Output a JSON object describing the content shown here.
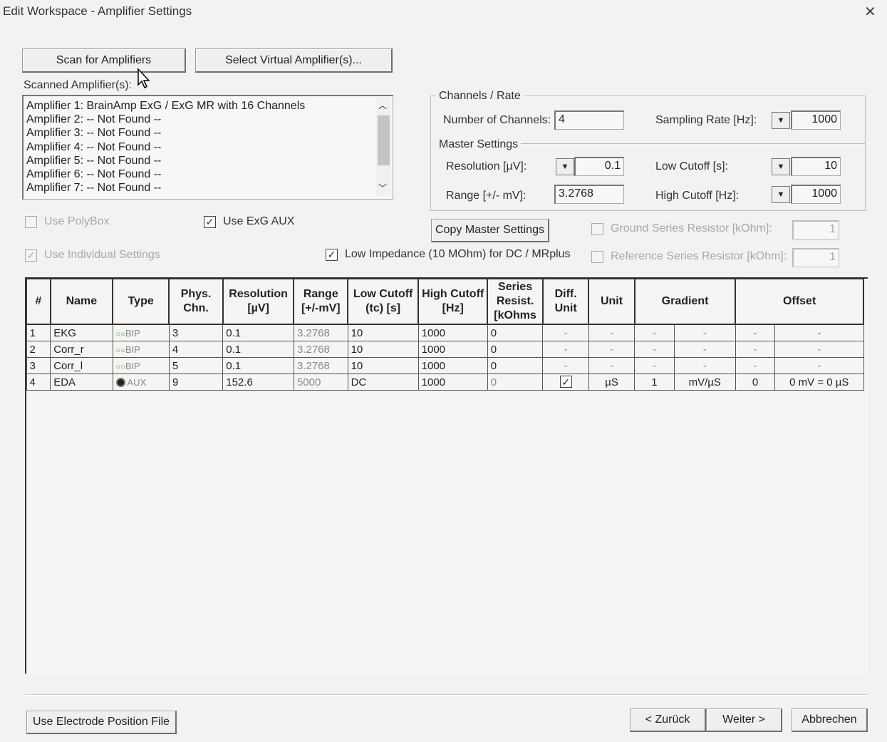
{
  "window": {
    "title": "Edit Workspace - Amplifier Settings",
    "close_glyph": "✕"
  },
  "buttons": {
    "scan": "Scan for Amplifiers",
    "select_virtual": "Select Virtual Amplifier(s)...",
    "copy_master": "Copy Master Settings",
    "use_electrode": "Use Electrode Position File",
    "back": "< Zurück",
    "next": "Weiter >",
    "cancel": "Abbrechen"
  },
  "scanned": {
    "label": "Scanned Amplifier(s):",
    "items": [
      "Amplifier 1: BrainAmp ExG / ExG MR with 16 Channels",
      "Amplifier 2: -- Not Found --",
      "Amplifier 3: -- Not Found --",
      "Amplifier 4: -- Not Found --",
      "Amplifier 5: -- Not Found --",
      "Amplifier 6: -- Not Found --",
      "Amplifier 7: -- Not Found --"
    ]
  },
  "options": {
    "use_polybox": {
      "label": "Use PolyBox",
      "checked": false,
      "enabled": false
    },
    "use_exg_aux": {
      "label": "Use ExG AUX",
      "checked": true,
      "enabled": true
    },
    "use_individual": {
      "label": "Use Individual Settings",
      "checked": true,
      "enabled": false
    },
    "low_impedance": {
      "label": "Low Impedance (10 MOhm) for DC / MRplus",
      "checked": true,
      "enabled": true
    },
    "ground_resistor": {
      "label": "Ground Series Resistor [kOhm]:",
      "value": "1",
      "enabled": false
    },
    "reference_resistor": {
      "label": "Reference Series Resistor [kOhm]:",
      "value": "1",
      "enabled": false
    }
  },
  "channels_rate": {
    "group_label": "Channels / Rate",
    "num_channels_label": "Number of Channels:",
    "num_channels": "4",
    "sampling_rate_label": "Sampling Rate [Hz]:",
    "sampling_rate": "1000"
  },
  "master": {
    "group_label": "Master Settings",
    "resolution_label": "Resolution [µV]:",
    "resolution": "0.1",
    "range_label": "Range [+/- mV]:",
    "range": "3.2768",
    "low_cutoff_label": "Low Cutoff [s]:",
    "low_cutoff": "10",
    "high_cutoff_label": "High Cutoff [Hz]:",
    "high_cutoff": "1000"
  },
  "table": {
    "headers": [
      "#",
      "Name",
      "Type",
      "Phys. Chn.",
      "Resolution [µV]",
      "Range [+/-mV]",
      "Low Cutoff (tc) [s]",
      "High Cutoff [Hz]",
      "Series Resist. [kOhms",
      "Diff. Unit",
      "Unit",
      "Gradient",
      "Offset"
    ],
    "rows": [
      {
        "num": "1",
        "name": "EKG",
        "type": "BIP",
        "chn": "3",
        "res": "0.1",
        "range": "3.2768",
        "low": "10",
        "high": "1000",
        "series": "0",
        "diff": "-",
        "unit": "-",
        "g1": "-",
        "g2": "-",
        "o1": "-",
        "o2": "-"
      },
      {
        "num": "2",
        "name": "Corr_r",
        "type": "BIP",
        "chn": "4",
        "res": "0.1",
        "range": "3.2768",
        "low": "10",
        "high": "1000",
        "series": "0",
        "diff": "-",
        "unit": "-",
        "g1": "-",
        "g2": "-",
        "o1": "-",
        "o2": "-"
      },
      {
        "num": "3",
        "name": "Corr_l",
        "type": "BIP",
        "chn": "5",
        "res": "0.1",
        "range": "3.2768",
        "low": "10",
        "high": "1000",
        "series": "0",
        "diff": "-",
        "unit": "-",
        "g1": "-",
        "g2": "-",
        "o1": "-",
        "o2": "-"
      },
      {
        "num": "4",
        "name": "EDA",
        "type": "AUX",
        "chn": "9",
        "res": "152.6",
        "range": "5000",
        "low": "DC",
        "high": "1000",
        "series": "0",
        "diff": "✓",
        "unit": "µS",
        "g1": "1",
        "g2": "mV/µS",
        "o1": "0",
        "o2": "0 mV = 0 µS"
      }
    ]
  }
}
